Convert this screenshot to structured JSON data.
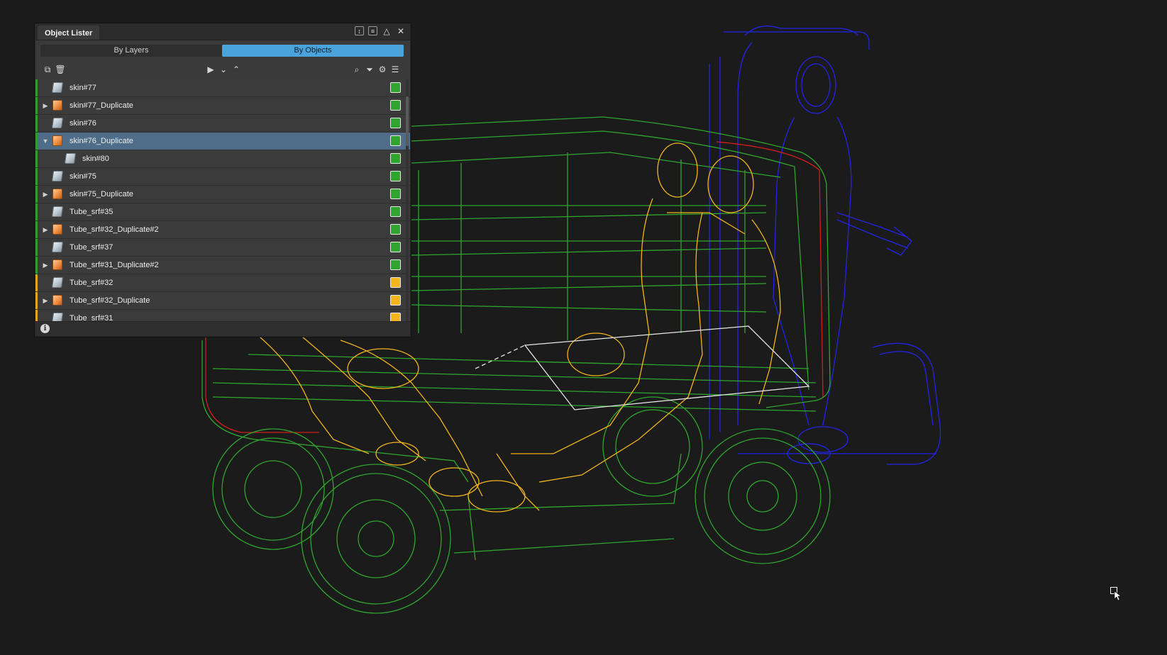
{
  "panel": {
    "title": "Object Lister",
    "tabs": [
      {
        "label": "By Layers",
        "active": false
      },
      {
        "label": "By Objects",
        "active": true
      }
    ],
    "titlebar_icons": [
      "resize-icon",
      "menu-icon",
      "collapse-icon",
      "close-icon"
    ],
    "toolbar_icons": [
      "duplicate-icon",
      "delete-icon",
      "play-icon",
      "chevron-down-icon",
      "chevron-up-icon",
      "search-icon",
      "filter-icon",
      "settings-icon",
      "list-menu-icon"
    ],
    "rows": [
      {
        "label": "skin#77",
        "type": "skin",
        "expand": "",
        "indent": 0,
        "stripe": "#2e9e2e",
        "swatch": "#2fa52f",
        "selected": false
      },
      {
        "label": "skin#77_Duplicate",
        "type": "group",
        "expand": "right",
        "indent": 0,
        "stripe": "#2e9e2e",
        "swatch": "#2fa52f",
        "selected": false
      },
      {
        "label": "skin#76",
        "type": "skin",
        "expand": "",
        "indent": 0,
        "stripe": "#2e9e2e",
        "swatch": "#2fa52f",
        "selected": false
      },
      {
        "label": "skin#76_Duplicate",
        "type": "group",
        "expand": "down",
        "indent": 0,
        "stripe": "#2e9e2e",
        "swatch": "#2fa52f",
        "selected": true
      },
      {
        "label": "skin#80",
        "type": "skin",
        "expand": "",
        "indent": 1,
        "stripe": "#2e9e2e",
        "swatch": "#2fa52f",
        "selected": false
      },
      {
        "label": "skin#75",
        "type": "skin",
        "expand": "",
        "indent": 0,
        "stripe": "#2e9e2e",
        "swatch": "#2fa52f",
        "selected": false
      },
      {
        "label": "skin#75_Duplicate",
        "type": "group",
        "expand": "right",
        "indent": 0,
        "stripe": "#2e9e2e",
        "swatch": "#2fa52f",
        "selected": false
      },
      {
        "label": "Tube_srf#35",
        "type": "skin",
        "expand": "",
        "indent": 0,
        "stripe": "#2e9e2e",
        "swatch": "#2fa52f",
        "selected": false
      },
      {
        "label": "Tube_srf#32_Duplicate#2",
        "type": "group",
        "expand": "right",
        "indent": 0,
        "stripe": "#2e9e2e",
        "swatch": "#2fa52f",
        "selected": false
      },
      {
        "label": "Tube_srf#37",
        "type": "skin",
        "expand": "",
        "indent": 0,
        "stripe": "#2e9e2e",
        "swatch": "#2fa52f",
        "selected": false
      },
      {
        "label": "Tube_srf#31_Duplicate#2",
        "type": "group",
        "expand": "right",
        "indent": 0,
        "stripe": "#2e9e2e",
        "swatch": "#2fa52f",
        "selected": false
      },
      {
        "label": "Tube_srf#32",
        "type": "skin",
        "expand": "",
        "indent": 0,
        "stripe": "#e0a81a",
        "swatch": "#f2b51c",
        "selected": false
      },
      {
        "label": "Tube_srf#32_Duplicate",
        "type": "group",
        "expand": "right",
        "indent": 0,
        "stripe": "#e0a81a",
        "swatch": "#f2b51c",
        "selected": false
      },
      {
        "label": "Tube_srf#31",
        "type": "skin",
        "expand": "",
        "indent": 0,
        "stripe": "#e0a81a",
        "swatch": "#f2b51c",
        "selected": false
      }
    ],
    "status_icon": "info-icon",
    "status_glyph": "i"
  },
  "viewport": {
    "colors": {
      "green": "#2fa52f",
      "yellow": "#f2b51c",
      "blue": "#2323e6",
      "red": "#d01e1e",
      "white": "#e8e8e8"
    },
    "cursor_icon": "cursor-icon"
  }
}
